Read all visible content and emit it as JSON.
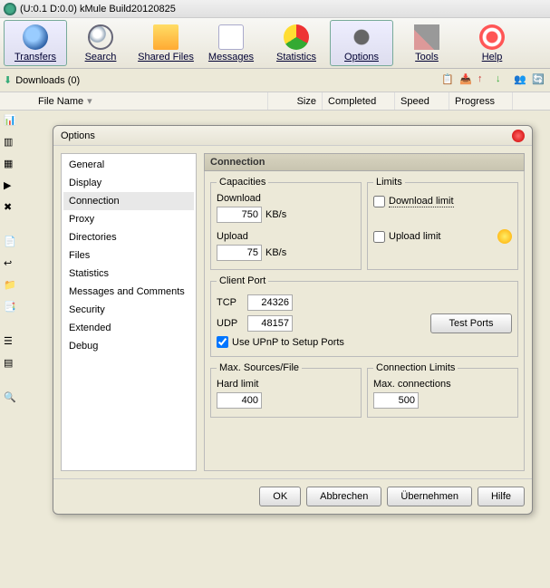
{
  "window": {
    "title": "(U:0.1 D:0.0) kMule Build20120825"
  },
  "toolbar": [
    {
      "label": "Transfers",
      "icon": "globe"
    },
    {
      "label": "Search",
      "icon": "search"
    },
    {
      "label": "Shared Files",
      "icon": "folder"
    },
    {
      "label": "Messages",
      "icon": "msg"
    },
    {
      "label": "Statistics",
      "icon": "stats"
    },
    {
      "label": "Options",
      "icon": "gear"
    },
    {
      "label": "Tools",
      "icon": "tools"
    },
    {
      "label": "Help",
      "icon": "help"
    }
  ],
  "subbar": {
    "downloads": "Downloads (0)"
  },
  "columns": {
    "filename": "File Name",
    "size": "Size",
    "completed": "Completed",
    "speed": "Speed",
    "progress": "Progress"
  },
  "dialog": {
    "title": "Options",
    "categories": [
      "General",
      "Display",
      "Connection",
      "Proxy",
      "Directories",
      "Files",
      "Statistics",
      "Messages and Comments",
      "Security",
      "Extended",
      "Debug"
    ],
    "selected": "Connection",
    "panel_title": "Connection",
    "capacities": {
      "legend": "Capacities",
      "download_lbl": "Download",
      "download_val": "750",
      "upload_lbl": "Upload",
      "upload_val": "75",
      "unit": "KB/s"
    },
    "limits": {
      "legend": "Limits",
      "dl_limit": "Download limit",
      "ul_limit": "Upload limit"
    },
    "clientport": {
      "legend": "Client Port",
      "tcp_lbl": "TCP",
      "tcp_val": "24326",
      "udp_lbl": "UDP",
      "udp_val": "48157",
      "test": "Test Ports",
      "upnp": "Use UPnP to Setup Ports"
    },
    "sources": {
      "legend": "Max. Sources/File",
      "hard_lbl": "Hard limit",
      "hard_val": "400"
    },
    "connlimits": {
      "legend": "Connection Limits",
      "max_lbl": "Max. connections",
      "max_val": "500"
    },
    "buttons": {
      "ok": "OK",
      "cancel": "Abbrechen",
      "apply": "Übernehmen",
      "help": "Hilfe"
    }
  }
}
